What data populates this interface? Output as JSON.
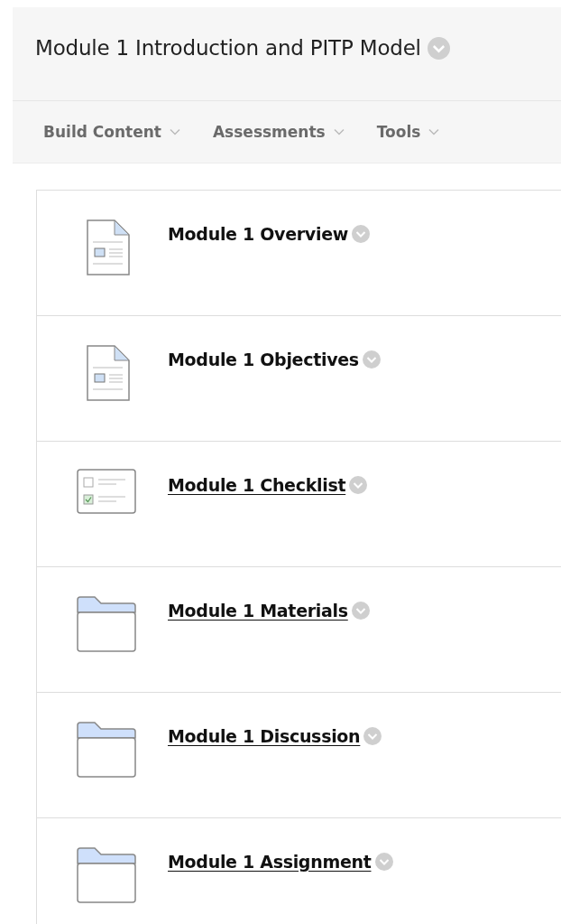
{
  "page_title": "Module 1 Introduction and PITP Model",
  "toolbar": [
    {
      "label": "Build Content"
    },
    {
      "label": "Assessments"
    },
    {
      "label": "Tools"
    }
  ],
  "items": [
    {
      "kind": "page",
      "title": "Module 1 Overview",
      "linked": false
    },
    {
      "kind": "page",
      "title": "Module 1 Objectives",
      "linked": false
    },
    {
      "kind": "checklist",
      "title": "Module 1 Checklist",
      "linked": true
    },
    {
      "kind": "folder",
      "title": "Module 1 Materials",
      "linked": true
    },
    {
      "kind": "folder",
      "title": "Module 1 Discussion",
      "linked": true
    },
    {
      "kind": "folder",
      "title": "Module 1 Assignment",
      "linked": true
    }
  ]
}
